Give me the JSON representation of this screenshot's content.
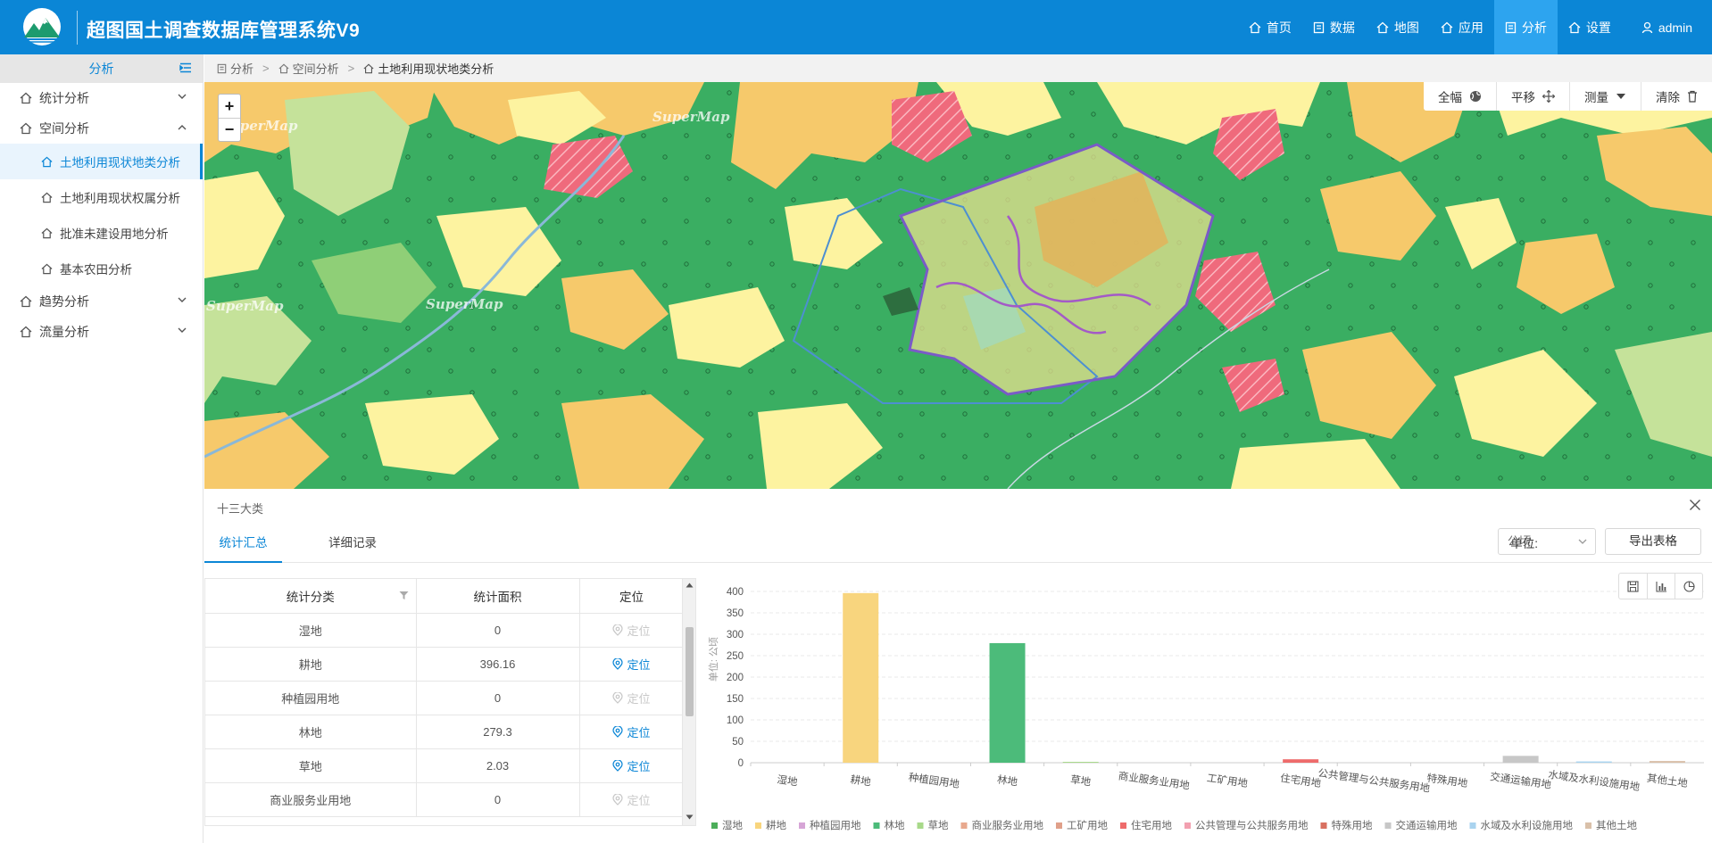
{
  "app": {
    "title": "超图国土调查数据库管理系统V9",
    "logo": "mountain-logo"
  },
  "nav": [
    {
      "label": "首页",
      "icon": "home-icon",
      "active": false
    },
    {
      "label": "数据",
      "icon": "list-icon",
      "active": false
    },
    {
      "label": "地图",
      "icon": "home-icon",
      "active": false
    },
    {
      "label": "应用",
      "icon": "home-icon",
      "active": false
    },
    {
      "label": "分析",
      "icon": "list-icon",
      "active": true
    },
    {
      "label": "设置",
      "icon": "home-icon",
      "active": false
    }
  ],
  "user": {
    "name": "admin",
    "icon": "user-icon"
  },
  "sidebar": {
    "title": "分析",
    "groups": [
      {
        "label": "统计分析",
        "expanded": false,
        "items": []
      },
      {
        "label": "空间分析",
        "expanded": true,
        "items": [
          {
            "label": "土地利用现状地类分析",
            "active": true
          },
          {
            "label": "土地利用现状权属分析",
            "active": false
          },
          {
            "label": "批准未建设用地分析",
            "active": false
          },
          {
            "label": "基本农田分析",
            "active": false
          }
        ]
      },
      {
        "label": "趋势分析",
        "expanded": false,
        "items": []
      },
      {
        "label": "流量分析",
        "expanded": false,
        "items": []
      }
    ]
  },
  "breadcrumb": [
    "分析",
    "空间分析",
    "土地利用现状地类分析"
  ],
  "map": {
    "zoom_in": "+",
    "zoom_out": "−",
    "watermark": "SuperMap",
    "tools": [
      {
        "label": "全幅",
        "icon": "globe-icon"
      },
      {
        "label": "平移",
        "icon": "move-icon"
      },
      {
        "label": "测量",
        "icon": "caret-down-icon"
      },
      {
        "label": "清除",
        "icon": "trash-icon"
      }
    ],
    "colors": {
      "forest": "#3aae62",
      "farmland": "#f6c96b",
      "grassland": "#fdf3a0",
      "urban": "#e66a7a",
      "boundary": "#7a5bc7"
    }
  },
  "panel": {
    "title": "十三大类",
    "tabs": [
      "统计汇总",
      "详细记录"
    ],
    "unit_label": "单位:",
    "unit_value": "公顷",
    "export_label": "导出表格",
    "table": {
      "headers": [
        "统计分类",
        "统计面积",
        "定位"
      ],
      "rows": [
        {
          "category": "湿地",
          "area": "0",
          "locate": "定位",
          "enabled": false
        },
        {
          "category": "耕地",
          "area": "396.16",
          "locate": "定位",
          "enabled": true
        },
        {
          "category": "种植园用地",
          "area": "0",
          "locate": "定位",
          "enabled": false
        },
        {
          "category": "林地",
          "area": "279.3",
          "locate": "定位",
          "enabled": true
        },
        {
          "category": "草地",
          "area": "2.03",
          "locate": "定位",
          "enabled": true
        },
        {
          "category": "商业服务业用地",
          "area": "0",
          "locate": "定位",
          "enabled": false
        }
      ]
    }
  },
  "chart_data": {
    "type": "bar",
    "ylabel": "单位: 公顷",
    "ylim": [
      0,
      400
    ],
    "yticks": [
      0,
      50,
      100,
      150,
      200,
      250,
      300,
      350,
      400
    ],
    "categories": [
      "湿地",
      "耕地",
      "种植园用地",
      "林地",
      "草地",
      "商业服务业用地",
      "工矿用地",
      "住宅用地",
      "公共管理与公共服务用地",
      "特殊用地",
      "交通运输用地",
      "水域及水利设施用地",
      "其他土地"
    ],
    "values": [
      0,
      396.16,
      0,
      279.3,
      2.03,
      0,
      0,
      8,
      0,
      0,
      16,
      3,
      4
    ],
    "colors": [
      "#4cae5a",
      "#f8d57e",
      "#d6a5d6",
      "#4cbb7a",
      "#a8d98a",
      "#e8a98e",
      "#e0a08a",
      "#ee6b6b",
      "#f2a0b0",
      "#d87060",
      "#c7c7c7",
      "#a9d3ef",
      "#d9c0a9"
    ],
    "legend_position": "bottom",
    "grid": true
  },
  "chart_tools": [
    {
      "icon": "save-icon"
    },
    {
      "icon": "bar-chart-icon"
    },
    {
      "icon": "pie-chart-icon"
    }
  ]
}
